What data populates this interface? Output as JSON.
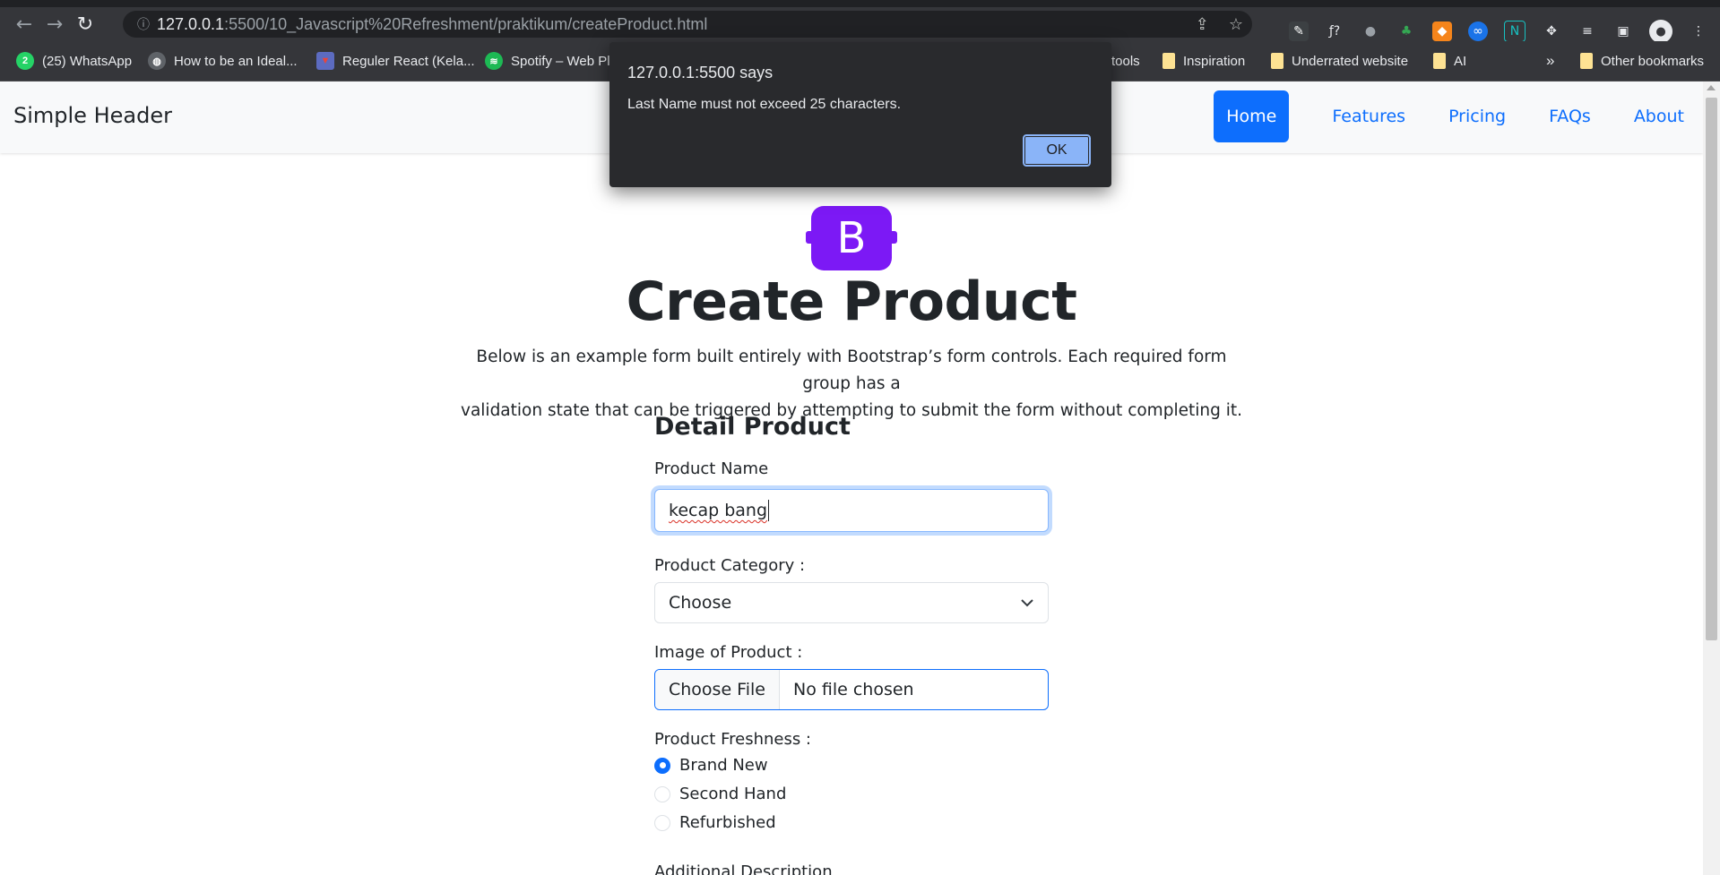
{
  "browser": {
    "url_host": "127.0.0.1",
    "url_rest": ":5500/10_Javascript%20Refreshment/praktikum/createProduct.html",
    "bookmarks": [
      {
        "label": "(25) WhatsApp",
        "icon": "whatsapp-icon",
        "color": "#25d366"
      },
      {
        "label": "How to be an Ideal...",
        "icon": "globe-icon",
        "color": "#9aa0a6"
      },
      {
        "label": "Reguler React (Kela...",
        "icon": "tie-icon",
        "color": "#e8453c"
      },
      {
        "label": "Spotify – Web Pl",
        "icon": "spotify-icon",
        "color": "#1db954"
      },
      {
        "label": "tools",
        "icon": "folder-icon",
        "color": "#fde293"
      },
      {
        "label": "Inspiration",
        "icon": "folder-icon",
        "color": "#fde293"
      },
      {
        "label": "Underrated website",
        "icon": "folder-icon",
        "color": "#fde293"
      },
      {
        "label": "AI",
        "icon": "folder-icon",
        "color": "#fde293"
      },
      {
        "label": "Other bookmarks",
        "icon": "folder-icon",
        "color": "#fde293"
      }
    ],
    "more_bookmarks": "»"
  },
  "header": {
    "brand": "Simple Header",
    "nav": [
      {
        "label": "Home",
        "active": true
      },
      {
        "label": "Features",
        "active": false
      },
      {
        "label": "Pricing",
        "active": false
      },
      {
        "label": "FAQs",
        "active": false
      },
      {
        "label": "About",
        "active": false
      }
    ]
  },
  "logo_letter": "B",
  "page_title": "Create Product",
  "lead_line1": "Below is an example form built entirely with Bootstrap’s form controls. Each required form group has a",
  "lead_line2": "validation state that can be triggered by attempting to submit the form without completing it.",
  "form": {
    "section_title": "Detail Product",
    "product_name_label": "Product Name",
    "product_name_value": "kecap bang",
    "category_label": "Product Category :",
    "category_selected": "Choose",
    "image_label": "Image of Product :",
    "file_button": "Choose File",
    "file_status": "No file chosen",
    "freshness_label": "Product Freshness :",
    "freshness_options": [
      {
        "label": "Brand New",
        "checked": true
      },
      {
        "label": "Second Hand",
        "checked": false
      },
      {
        "label": "Refurbished",
        "checked": false
      }
    ],
    "additional_label": "Additional Description"
  },
  "dialog": {
    "title": "127.0.0.1:5500 says",
    "message": "Last Name must not exceed 25 characters.",
    "ok": "OK"
  },
  "colors": {
    "primary": "#0d6efd",
    "bootstrap_purple": "#7c19f5",
    "dialog_bg": "#292a2d",
    "dialog_button": "#8ab4f8"
  }
}
